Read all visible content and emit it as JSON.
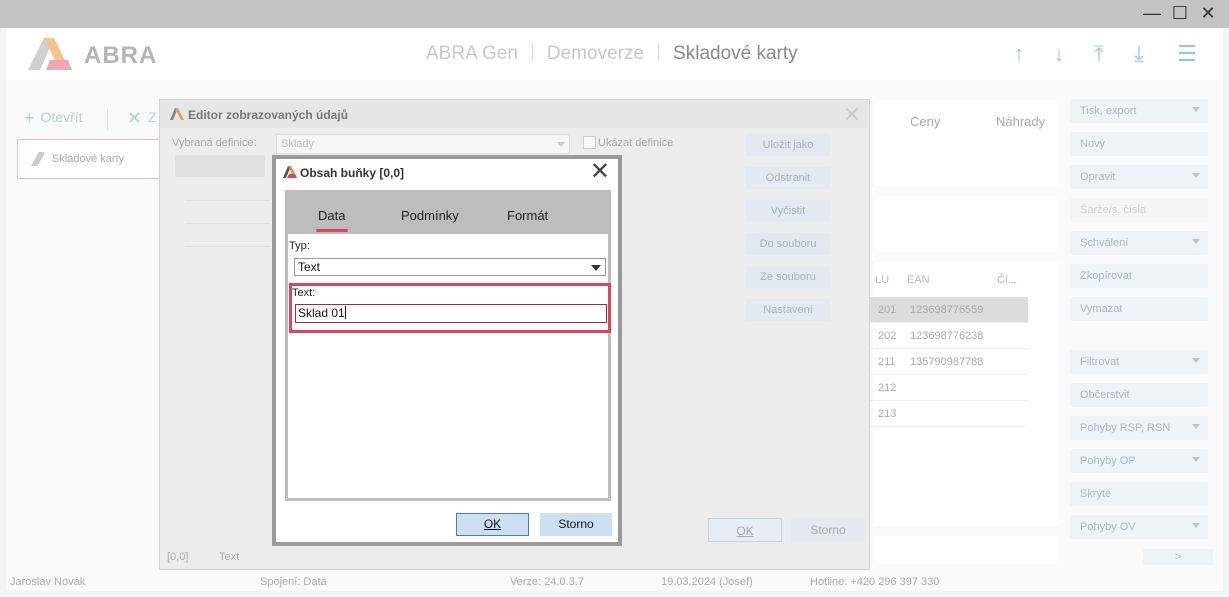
{
  "app": {
    "logo_text": "ABRA",
    "breadcrumbs": [
      "ABRA Gen",
      "Demoverze",
      "Skladové karty"
    ]
  },
  "toolbar": {
    "open_label": "Otevřít",
    "close_label": "Z"
  },
  "tree": {
    "item_label": "Skladové karty"
  },
  "background_tabs": [
    "Ceny",
    "Náhrady"
  ],
  "grid": {
    "headers": [
      "LU",
      "EAN",
      "Čí..."
    ],
    "rows": [
      {
        "plu": "201",
        "ean": "123698776559"
      },
      {
        "plu": "202",
        "ean": "123698776238"
      },
      {
        "plu": "211",
        "ean": "135790987788"
      },
      {
        "plu": "212",
        "ean": ""
      },
      {
        "plu": "213",
        "ean": ""
      }
    ]
  },
  "side_buttons": [
    {
      "label": "Tisk, export",
      "dropdown": true
    },
    {
      "label": "Nový",
      "dropdown": false
    },
    {
      "label": "Opravit",
      "dropdown": true
    },
    {
      "label": "Šarže/s. čísla",
      "dropdown": false
    },
    {
      "label": "Schválení",
      "dropdown": true
    },
    {
      "label": "Zkopírovat",
      "dropdown": false
    },
    {
      "label": "Vymazat",
      "dropdown": false
    },
    {
      "label": "Filtrovat",
      "dropdown": true
    },
    {
      "label": "Občerstvit",
      "dropdown": false
    },
    {
      "label": "Pohyby RSP, RSN",
      "dropdown": true
    },
    {
      "label": "Pohyby OP",
      "dropdown": true
    },
    {
      "label": "Skryté",
      "dropdown": false
    },
    {
      "label": "Pohyby OV",
      "dropdown": true
    }
  ],
  "side_more": ">",
  "status": {
    "user": "Jaroslav Novák",
    "connection": "Spojení: Data",
    "version": "Verze: 24.0.3.7",
    "date": "19.03.2024 (Josef)",
    "hotline": "Hotline: +420 296 397 330"
  },
  "editor": {
    "title": "Editor zobrazovaných údajů",
    "definition_label": "Vybraná definice:",
    "definition_value": "Sklady",
    "show_definition_label": "Ukázat definice",
    "buttons": [
      "Uložit jako",
      "Odstranit",
      "Vyčistit",
      "Do souboru",
      "Ze souboru",
      "Nastavení"
    ],
    "ok_label": "OK",
    "cancel_label": "Storno",
    "footer_cell": "[0,0]",
    "footer_type": "Text"
  },
  "cell_dialog": {
    "title": "Obsah buňky [0,0]",
    "tabs": [
      "Data",
      "Podmínky",
      "Formát"
    ],
    "active_tab": "Data",
    "type_label": "Typ:",
    "type_value": "Text",
    "text_label": "Text:",
    "text_value": "Sklad 01",
    "ok_label": "OK",
    "cancel_label": "Storno"
  },
  "colors": {
    "accent_red": "#d9475f",
    "header_icon_blue": "#9cc4ea",
    "button_blue": "#cde0f3"
  }
}
